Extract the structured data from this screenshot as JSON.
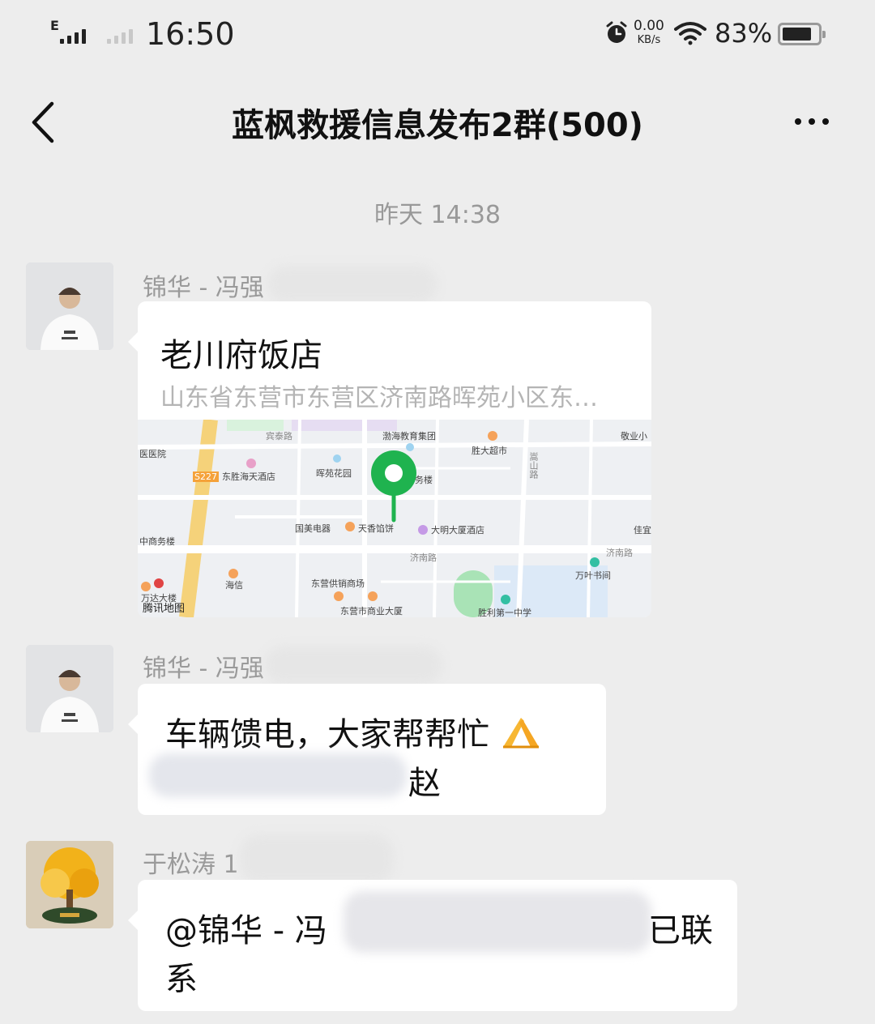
{
  "status_bar": {
    "network_type": "E",
    "time": "16:50",
    "net_speed_value": "0.00",
    "net_speed_unit": "KB/s",
    "battery_percent": "83%",
    "battery_level": 0.83
  },
  "nav": {
    "title": "蓝枫救援信息发布2群(500)",
    "back_icon": "chevron-left-icon",
    "more_icon": "more-dots-icon"
  },
  "timestamp": "昨天 14:38",
  "messages": [
    {
      "sender": "锦华 - 冯强",
      "type": "location",
      "location": {
        "name": "老川府饭店",
        "address": "山东省东营市东营区济南路晖苑小区东…",
        "map_provider": "腾讯地图",
        "labels": {
          "binyue_road": "宾泰路",
          "bohai_edu": "渤海教育集团",
          "shengda": "胜大超市",
          "jingyexiao": "敬业小",
          "hospital": "医医院",
          "s227": "S227",
          "dongsheng_hotel": "东胜海天酒店",
          "huiyuan_garden": "晖苑花园",
          "wulou": "务楼",
          "gome": "国美电器",
          "tianxiang": "天香馅饼",
          "daming_hotel": "大明大厦酒店",
          "jiayi": "佳宜",
          "zhongshang": "中商务楼",
          "songshan_road": "嵩山路",
          "jinan_road_1": "济南路",
          "jinan_road_2": "济南路",
          "wanye_bookstore": "万叶书间",
          "haixin": "海信",
          "dongying_supply": "东营供销商场",
          "dongying_building": "东营市商业大厦",
          "shengli_school": "胜利第一中学",
          "wanda": "万达大楼"
        }
      }
    },
    {
      "sender": "锦华 - 冯强",
      "type": "text",
      "line1": "车辆馈电，大家帮帮忙",
      "line1_emoji": "folded-hands-emoji",
      "line2": "赵"
    },
    {
      "sender": "于松涛 1",
      "type": "text",
      "line1_prefix": "@锦华 - 冯",
      "line1_suffix": "已联",
      "line2": "系"
    }
  ],
  "colors": {
    "background": "#ededed",
    "bubble": "#ffffff",
    "map_pin": "#1fb34f"
  }
}
